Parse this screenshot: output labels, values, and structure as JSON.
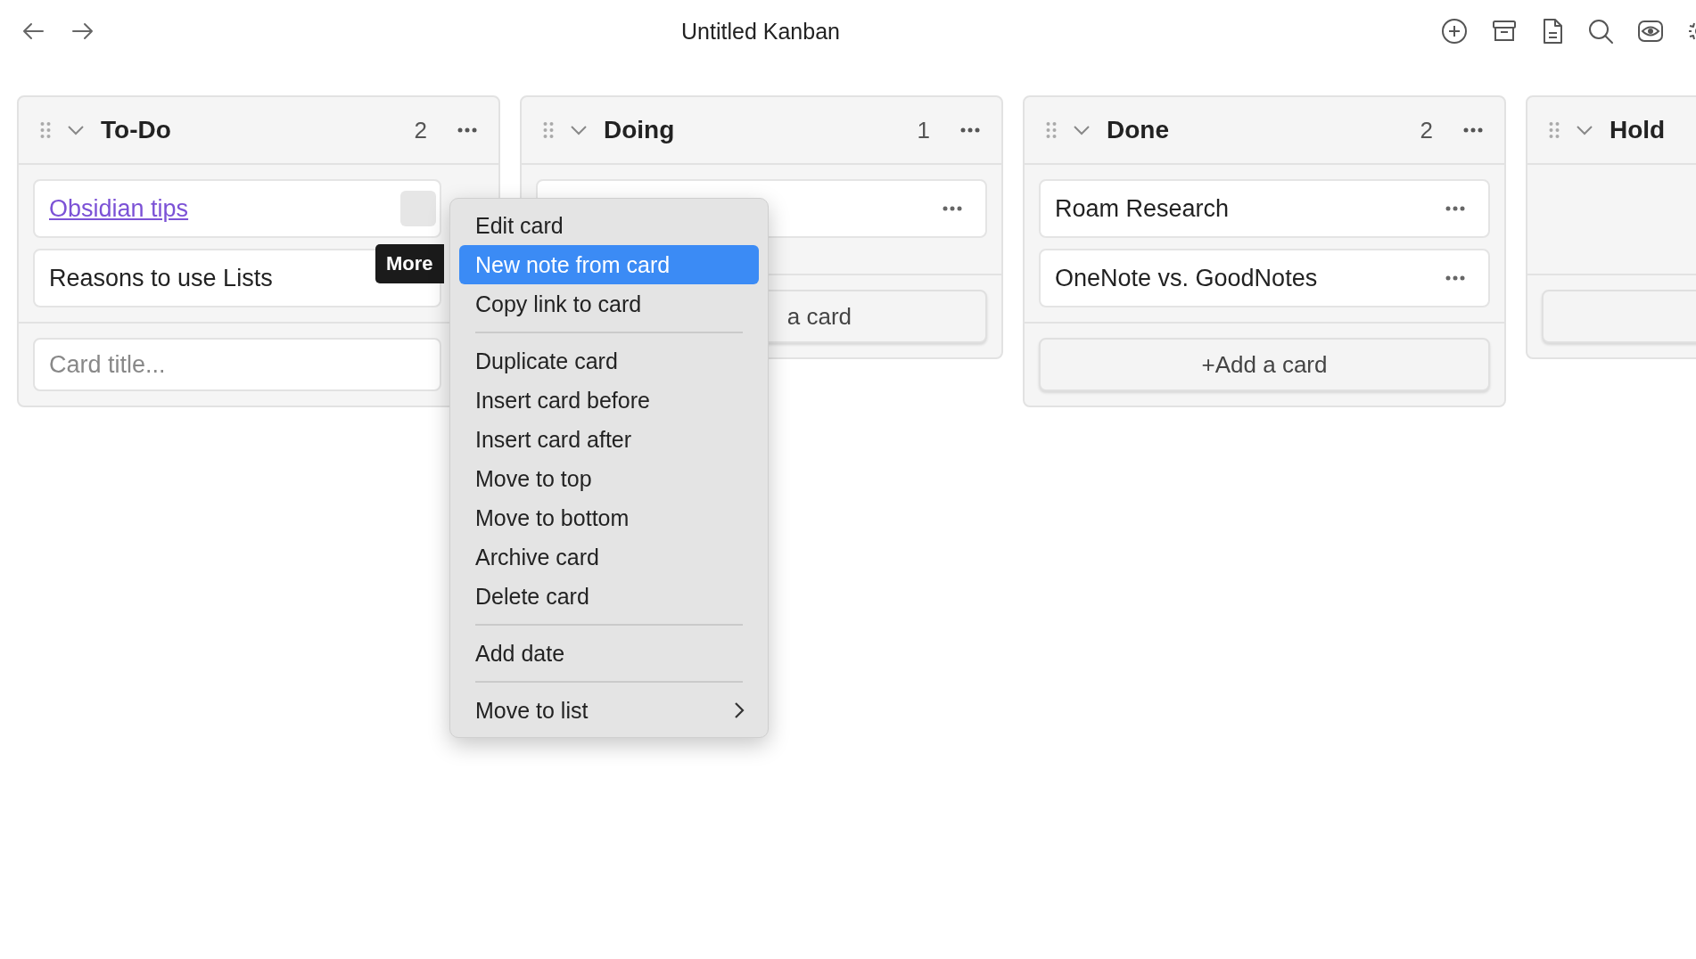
{
  "toolbar": {
    "title": "Untitled Kanban"
  },
  "lanes": [
    {
      "title": "To-Do",
      "count": "2",
      "cards": [
        {
          "title": "Obsidian tips",
          "kind": "link",
          "hovered": true,
          "more_icon": false
        },
        {
          "title": "Reasons to use Lists",
          "kind": "text"
        }
      ],
      "footer": {
        "kind": "input",
        "placeholder": "Card title..."
      }
    },
    {
      "title": "Doing",
      "count": "1",
      "cards": [
        {
          "kind": "covered",
          "hovered": false,
          "more_icon": true
        }
      ],
      "footer": {
        "kind": "button",
        "label": "a card",
        "partial": true
      }
    },
    {
      "title": "Done",
      "count": "2",
      "cards": [
        {
          "title": "Roam Research",
          "kind": "text",
          "hovered": false,
          "more_icon": true
        },
        {
          "title": "OneNote vs. GoodNotes",
          "kind": "text",
          "hovered": false,
          "more_icon": true
        }
      ],
      "footer": {
        "kind": "button",
        "label": "+Add a card",
        "partial": false
      }
    },
    {
      "title": "Hold",
      "footer": {
        "kind": "button"
      }
    }
  ],
  "tooltip": {
    "text": "More"
  },
  "menu": {
    "sections": [
      [
        {
          "label": "Edit card",
          "selected": false
        },
        {
          "label": "New note from card",
          "selected": true
        },
        {
          "label": "Copy link to card",
          "selected": false
        }
      ],
      [
        {
          "label": "Duplicate card",
          "selected": false
        },
        {
          "label": "Insert card before",
          "selected": false
        },
        {
          "label": "Insert card after",
          "selected": false
        },
        {
          "label": "Move to top",
          "selected": false
        },
        {
          "label": "Move to bottom",
          "selected": false
        },
        {
          "label": "Archive card",
          "selected": false
        },
        {
          "label": "Delete card",
          "selected": false
        }
      ],
      [
        {
          "label": "Add date",
          "selected": false
        }
      ],
      [
        {
          "label": "Move to list",
          "selected": false,
          "submenu": true
        }
      ]
    ]
  }
}
